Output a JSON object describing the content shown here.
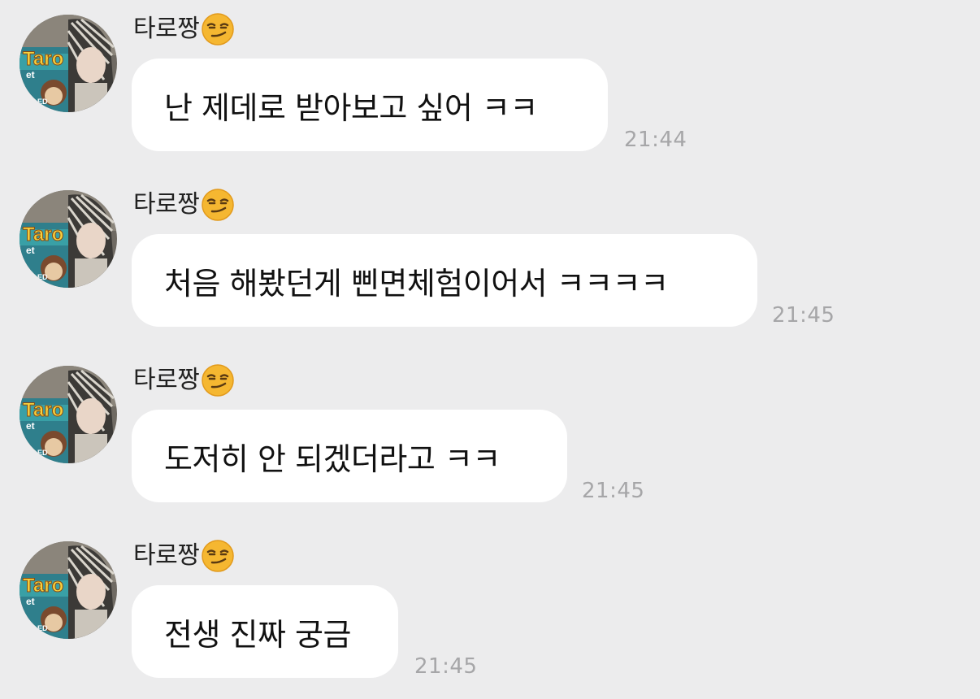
{
  "messages": [
    {
      "sender": "타로짱",
      "text": "난 제데로 받아보고 싶어 ㅋㅋ",
      "time": "21:44"
    },
    {
      "sender": "타로짱",
      "text": "처음 해봤던게 삔면체험이어서 ㅋㅋㅋㅋ",
      "time": "21:45"
    },
    {
      "sender": "타로짱",
      "text": "도저히 안 되겠더라고 ㅋㅋ",
      "time": "21:45"
    },
    {
      "sender": "타로짱",
      "text": "전생 진짜 궁금",
      "time": "21:45"
    }
  ],
  "avatar_text": [
    "Taro",
    "et",
    "ED"
  ],
  "emoji_icon": "smirking-face-icon",
  "colors": {
    "background": "#ececed",
    "bubble": "#ffffff",
    "timestamp": "#a6a6a8",
    "emoji": "#f5b731"
  }
}
